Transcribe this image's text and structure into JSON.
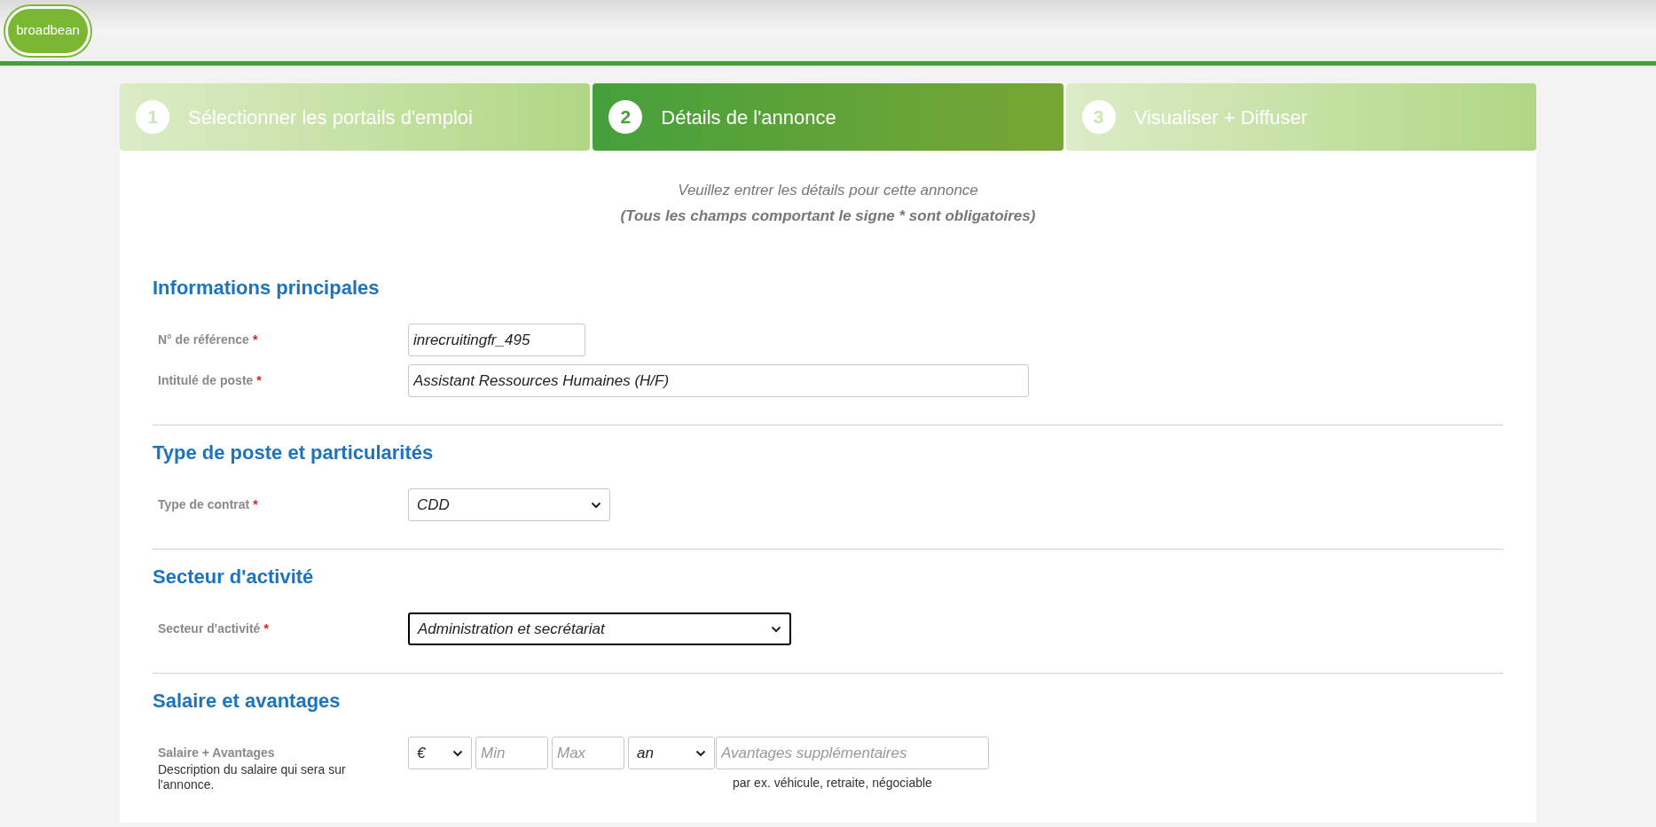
{
  "logo": {
    "text": "broadbean"
  },
  "steps": [
    {
      "number": "1",
      "label": "Sélectionner les portails d'emploi",
      "selected": false
    },
    {
      "number": "2",
      "label": "Détails de l'annonce",
      "selected": true
    },
    {
      "number": "3",
      "label": "Visualiser + Diffuser",
      "selected": false
    }
  ],
  "intro": {
    "line": "Veuillez entrer les détails pour cette annonce",
    "note": "(Tous les champs comportant le signe * sont obligatoires)"
  },
  "sections": [
    {
      "title": "Informations principales",
      "fields": [
        {
          "kind": "text",
          "label": "N° de référence",
          "required_mark": "*",
          "value": "inrecruitingfr_495"
        },
        {
          "kind": "text",
          "label": "Intitulé de poste",
          "required_mark": "*",
          "value": "Assistant Ressources Humaines (H/F)"
        }
      ]
    },
    {
      "title": "Type de poste et particularités",
      "fields": [
        {
          "kind": "select",
          "label": "Type de contrat",
          "required_mark": "*",
          "value": "CDD",
          "focused": false
        }
      ]
    },
    {
      "title": "Secteur d'activité",
      "fields": [
        {
          "kind": "select",
          "label": "Secteur d'activité",
          "required_mark": "*",
          "value": "Administration et secrétariat",
          "focused": true
        }
      ]
    },
    {
      "title": "Salaire et avantages",
      "fields": [
        {
          "kind": "salary",
          "label": "Salaire + Avantages",
          "description": "Description du salaire qui sera sur l'annonce.",
          "currency": "€",
          "min_placeholder": "Min",
          "max_placeholder": "Max",
          "period": "an",
          "benefits_placeholder": "Avantages supplémentaires",
          "hint": "par ex. véhicule, retraite, négociable"
        }
      ]
    }
  ]
}
